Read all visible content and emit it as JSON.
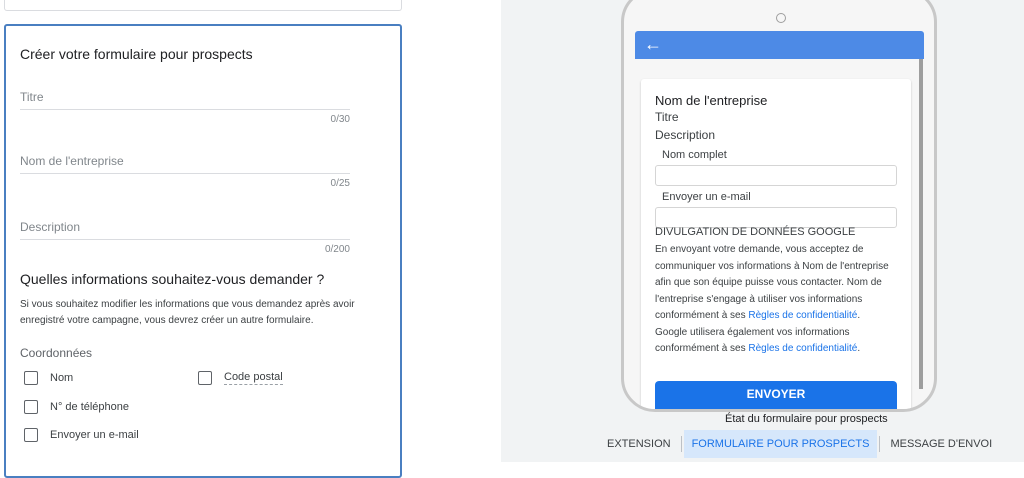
{
  "form": {
    "title": "Créer votre formulaire pour prospects",
    "fields": [
      {
        "label": "Titre",
        "counter": "0/30"
      },
      {
        "label": "Nom de l'entreprise",
        "counter": "0/25"
      },
      {
        "label": "Description",
        "counter": "0/200"
      }
    ],
    "question_heading": "Quelles informations souhaitez-vous demander ?",
    "question_note": "Si vous souhaitez modifier les informations que vous demandez après avoir enregistré votre campagne, vous devrez créer un autre formulaire.",
    "contact_group": "Coordonnées",
    "checkboxes": [
      {
        "label": "Nom",
        "checked": false
      },
      {
        "label": "Code postal",
        "checked": false
      },
      {
        "label": "N° de téléphone",
        "checked": false
      },
      {
        "label": "Envoyer un e-mail",
        "checked": false
      }
    ]
  },
  "preview": {
    "company": "Nom de l'entreprise",
    "title": "Titre",
    "description": "Description",
    "field_full_name": "Nom complet",
    "field_email": "Envoyer un e-mail",
    "disclosure_title": "DIVULGATION DE DONNÉES GOOGLE",
    "disclosure_part1": "En envoyant votre demande, vous acceptez de communiquer vos informations à Nom de l'entreprise afin que son équipe puisse vous contacter. Nom de l'entreprise s'engage à utiliser vos informations conformément à ses ",
    "disclosure_link1": "Règles de confidentialité",
    "disclosure_part2": ". Google utilisera également vos informations conformément à ses ",
    "disclosure_link2": "Règles de confidentialité",
    "disclosure_part3": ".",
    "send_label": "ENVOYER",
    "state_label": "État du formulaire pour prospects"
  },
  "tabs": [
    {
      "label": "EXTENSION",
      "active": false
    },
    {
      "label": "FORMULAIRE POUR PROSPECTS",
      "active": true
    },
    {
      "label": "MESSAGE D'ENVOI",
      "active": false
    }
  ],
  "icons": {
    "back": "arrow-left-icon"
  },
  "colors": {
    "accent": "#1a73e8",
    "appbar": "#4d8ae6",
    "selected_border": "#4a7fc1"
  }
}
